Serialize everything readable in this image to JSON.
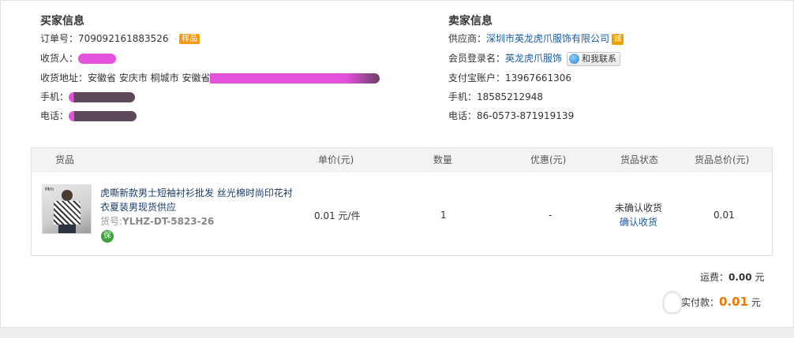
{
  "buyer": {
    "title": "买家信息",
    "order_label": "订单号：",
    "order_no": "709092161883526",
    "sample_badge": "样品",
    "receiver_label": "收货人：",
    "receiver_value": "",
    "address_label": "收货地址：",
    "address_value": "安徽省 安庆市 桐城市 安徽省",
    "mobile_label": "手机：",
    "mobile_value": "",
    "phone_label": "电话：",
    "phone_value": ""
  },
  "seller": {
    "title": "卖家信息",
    "supplier_label": "供应商：",
    "supplier_value": "深圳市英龙虎爪服饰有限公司",
    "cheng_badge": "诚",
    "member_label": "会员登录名：",
    "member_value": "英龙虎爪服饰",
    "contact_button": "和我联系",
    "alipay_label": "支付宝账户：",
    "alipay_value": "13967661306",
    "mobile_label": "手机：",
    "mobile_value": "18585212948",
    "phone_label": "电话：",
    "phone_value": "86-0573-871919139"
  },
  "table": {
    "headers": {
      "goods": "货品",
      "unit_price": "单价(元)",
      "quantity": "数量",
      "discount": "优惠(元)",
      "status": "货品状态",
      "total": "货品总价(元)"
    },
    "item": {
      "image_brand": "Mm",
      "title": "虎嘶新款男士短袖衬衫批发 丝光棉时尚印花衬衣夏装男现货供应",
      "sku_label": "货号:",
      "sku": "YLHZ-DT-5823-26",
      "guarantee_badge": "保",
      "unit_price": "0.01 元/件",
      "quantity": "1",
      "discount": "-",
      "status": "未确认收货",
      "confirm_link": "确认收货",
      "total": "0.01"
    }
  },
  "summary": {
    "shipping_label": "运费：",
    "shipping_value": "0.00",
    "shipping_unit": "元",
    "paid_label": "实付款：",
    "paid_value": "0.01",
    "paid_unit": "元"
  },
  "colors": {
    "link": "#1a5ba6",
    "accent_orange": "#f07800",
    "redaction": "#e03fd6"
  }
}
